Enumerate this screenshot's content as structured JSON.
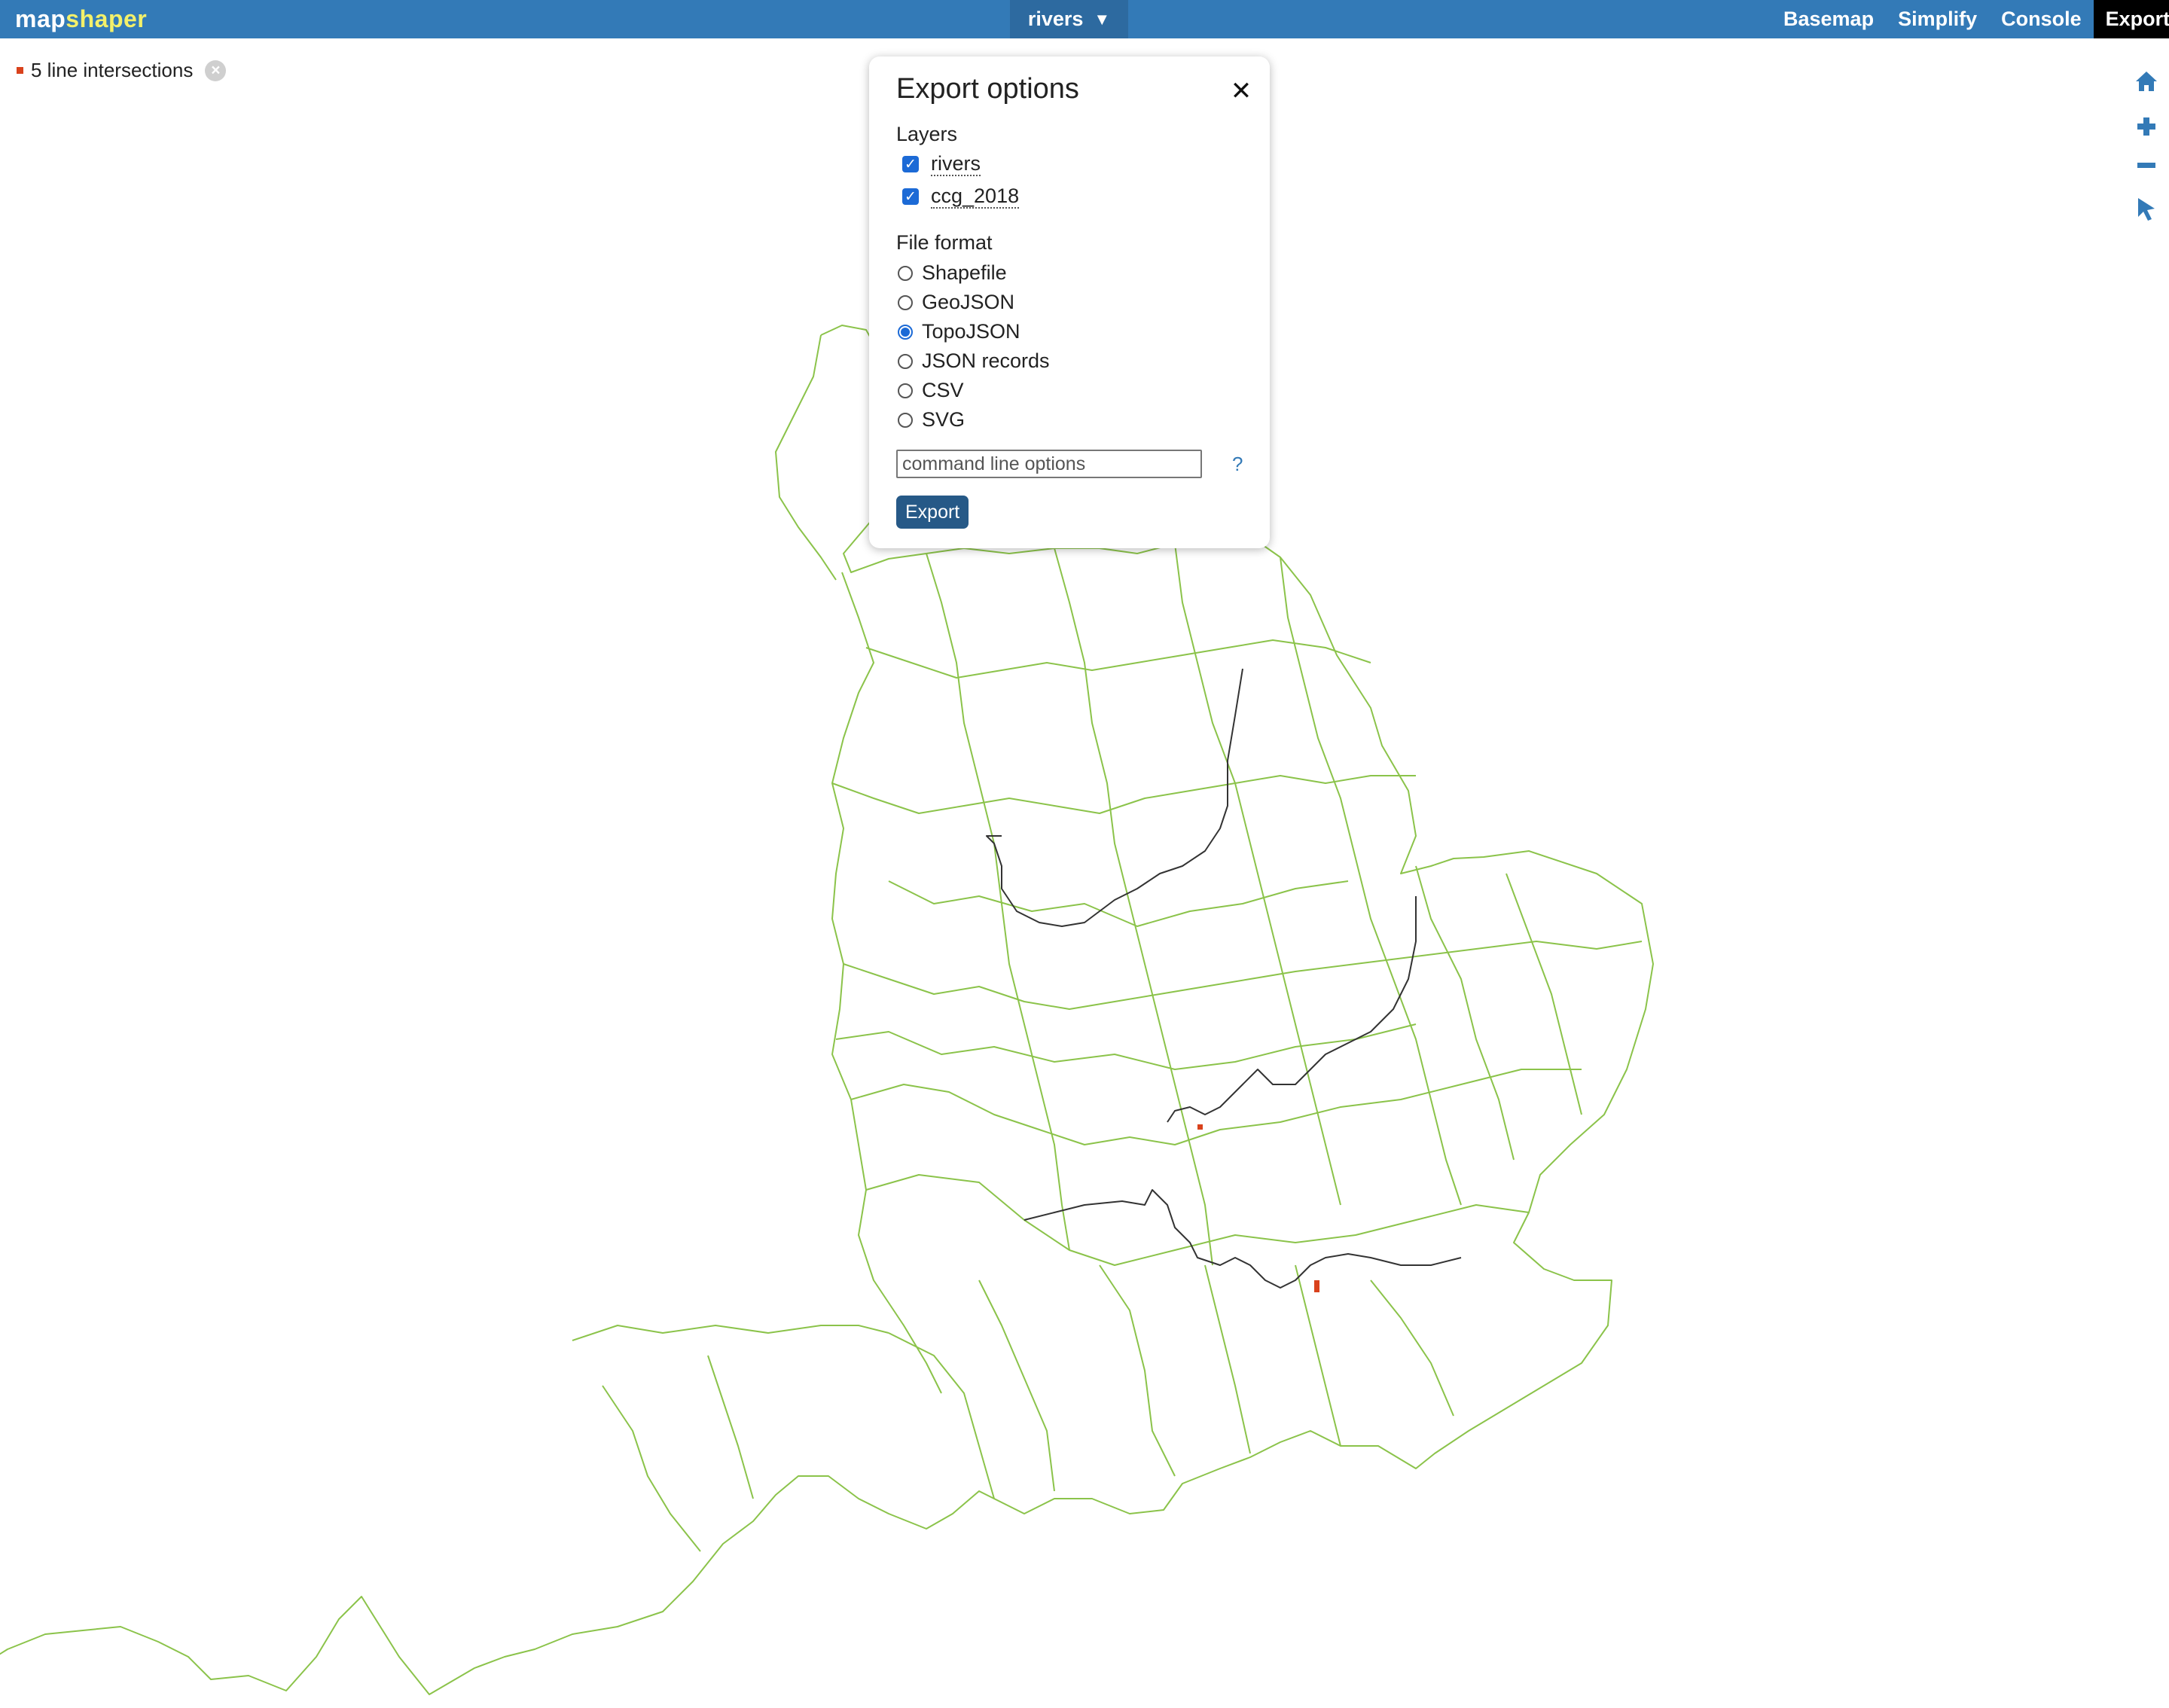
{
  "app": {
    "logo_part1": "map",
    "logo_part2": "shaper"
  },
  "layer_menu": {
    "label": "rivers",
    "arrow": "▼"
  },
  "nav": {
    "basemap": "Basemap",
    "simplify": "Simplify",
    "console": "Console",
    "export": "Export"
  },
  "status": {
    "intersections": "5 line intersections"
  },
  "tools": [
    "home-icon",
    "zoom-in-icon",
    "zoom-out-icon",
    "pointer-icon"
  ],
  "export_panel": {
    "title": "Export options",
    "close": "✕",
    "layers_label": "Layers",
    "layers": [
      {
        "name": "rivers",
        "checked": true
      },
      {
        "name": "ccg_2018",
        "checked": true
      }
    ],
    "format_label": "File format",
    "formats": [
      {
        "name": "Shapefile",
        "selected": false
      },
      {
        "name": "GeoJSON",
        "selected": false
      },
      {
        "name": "TopoJSON",
        "selected": true
      },
      {
        "name": "JSON records",
        "selected": false
      },
      {
        "name": "CSV",
        "selected": false
      },
      {
        "name": "SVG",
        "selected": false
      }
    ],
    "options_placeholder": "command line options",
    "help": "?",
    "export_button": "Export"
  },
  "colors": {
    "topbar": "#337ab7",
    "logo_accent": "#f3f06a",
    "boundary_lines": "#8bc34a",
    "river_lines": "#333333",
    "intersection_points": "#d9421c"
  }
}
